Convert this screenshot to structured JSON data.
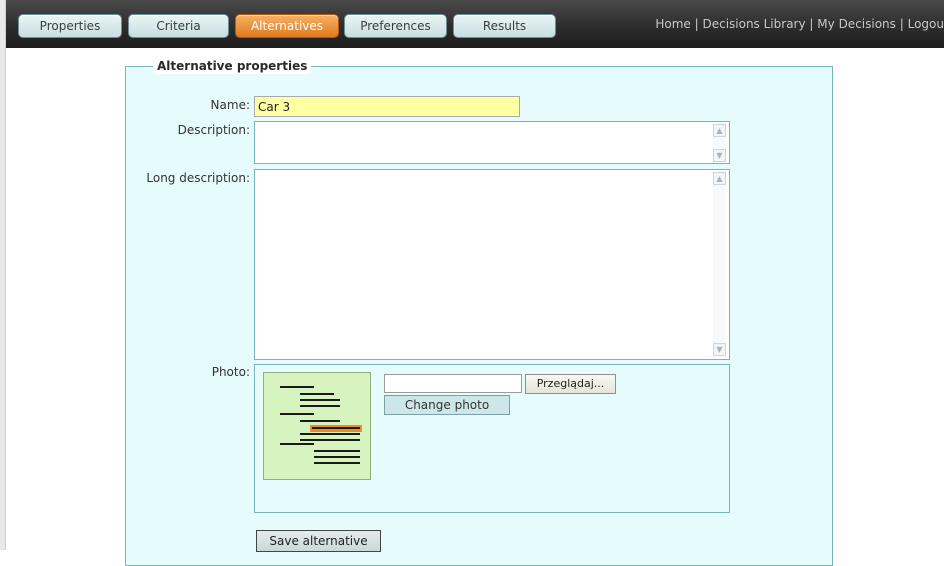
{
  "nav": {
    "tabs": [
      {
        "label": "Properties"
      },
      {
        "label": "Criteria"
      },
      {
        "label": "Alternatives"
      },
      {
        "label": "Preferences"
      },
      {
        "label": "Results"
      }
    ],
    "active_tab": "Alternatives",
    "links": {
      "home": "Home",
      "library": "Decisions Library",
      "my_decisions": "My Decisions",
      "logout": "Logou",
      "separator": "|"
    }
  },
  "form": {
    "legend": "Alternative properties",
    "name_label": "Name:",
    "name_value": "Car 3",
    "description_label": "Description:",
    "description_value": "",
    "long_description_label": "Long description:",
    "long_description_value": "",
    "photo_label": "Photo:",
    "file_input_value": "",
    "browse_label": "Przeglądaj...",
    "change_photo_label": "Change photo",
    "save_label": "Save alternative"
  },
  "colors": {
    "active_tab": "#e0791e",
    "tab": "#c9dfe0",
    "fieldset_bg": "#e6fbfc",
    "name_field_bg": "#ffffa3",
    "thumbnail_bg": "#d7f4c0",
    "thumbnail_highlight": "#f08a24"
  },
  "icons": {
    "thumbnail": "document-lines-icon",
    "scroll_up": "scroll-up-icon",
    "scroll_down": "scroll-down-icon"
  }
}
